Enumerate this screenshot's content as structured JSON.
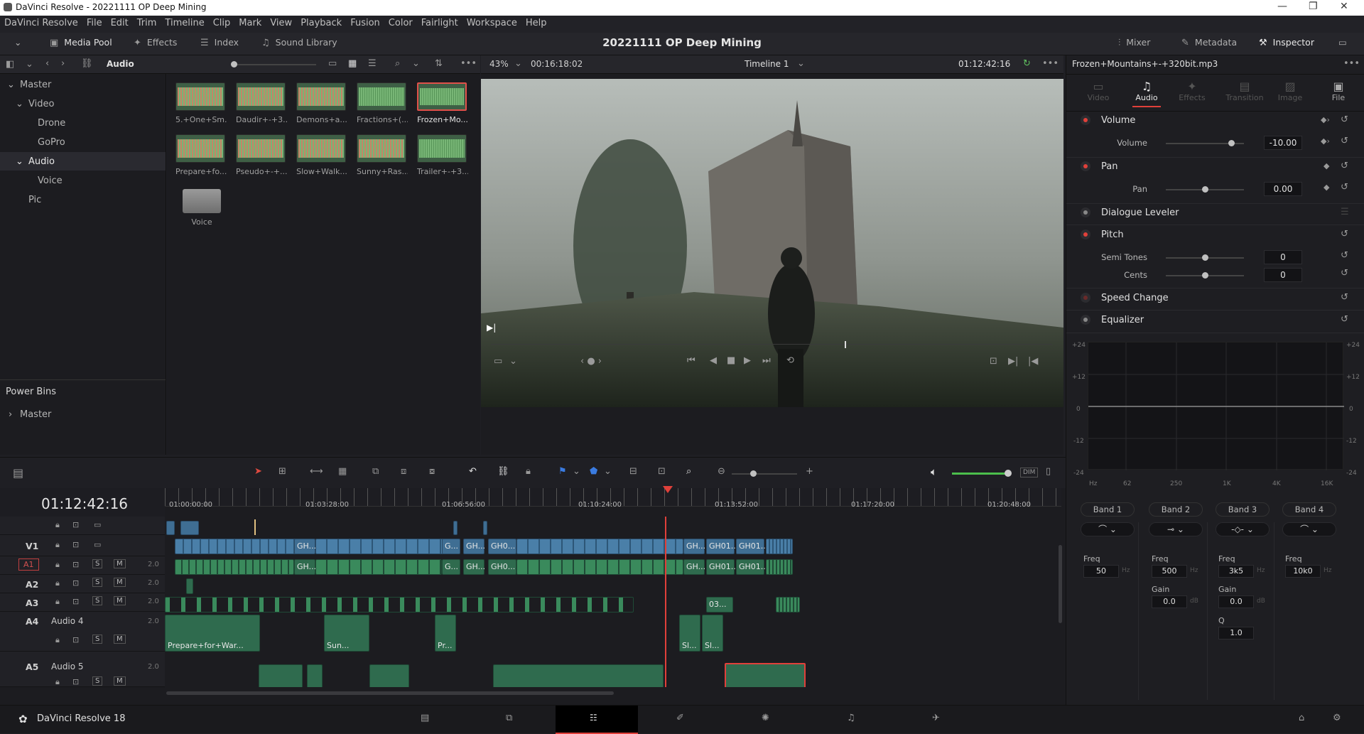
{
  "window": {
    "title": "DaVinci Resolve - 20221111 OP Deep Mining"
  },
  "menu": [
    "DaVinci Resolve",
    "File",
    "Edit",
    "Trim",
    "Timeline",
    "Clip",
    "Mark",
    "View",
    "Playback",
    "Fusion",
    "Color",
    "Fairlight",
    "Workspace",
    "Help"
  ],
  "toolbar": {
    "media_pool": "Media Pool",
    "effects": "Effects",
    "index": "Index",
    "sound_library": "Sound Library",
    "project_title": "20221111 OP Deep Mining",
    "mixer": "Mixer",
    "metadata": "Metadata",
    "inspector": "Inspector"
  },
  "media_pool": {
    "current_bin": "Audio",
    "bins": [
      {
        "label": "Master"
      },
      {
        "label": "Video"
      },
      {
        "label": "Drone"
      },
      {
        "label": "GoPro"
      },
      {
        "label": "Audio"
      },
      {
        "label": "Voice"
      },
      {
        "label": "Pic"
      }
    ],
    "power_bins_title": "Power Bins",
    "power_bins_master": "Master",
    "clips": [
      "5.+One+Sm...",
      "Daudir+-+3...",
      "Demons+a...",
      "Fractions+(...",
      "Frozen+Mo...",
      "Prepare+fo...",
      "Pseudo+-+...",
      "Slow+Walk...",
      "Sunny+Ras...",
      "Trailer+-+3...",
      "Voice"
    ]
  },
  "viewer": {
    "zoom": "43%",
    "duration": "00:16:18:02",
    "timeline_name": "Timeline 1",
    "timecode": "01:12:42:16"
  },
  "inspector": {
    "clip_name": "Frozen+Mountains+-+320bit.mp3",
    "tabs": [
      "Video",
      "Audio",
      "Effects",
      "Transition",
      "Image",
      "File"
    ],
    "volume": {
      "title": "Volume",
      "param": "Volume",
      "value": "-10.00"
    },
    "pan": {
      "title": "Pan",
      "param": "Pan",
      "value": "0.00"
    },
    "dialogue": {
      "title": "Dialogue Leveler"
    },
    "pitch": {
      "title": "Pitch",
      "semitones_label": "Semi Tones",
      "semitones": "0",
      "cents_label": "Cents",
      "cents": "0"
    },
    "speed": {
      "title": "Speed Change"
    },
    "eq": {
      "title": "Equalizer",
      "y_labels": [
        "+24",
        "+12",
        "0",
        "-12",
        "-24"
      ],
      "x_labels": [
        "Hz",
        "62",
        "250",
        "1K",
        "4K",
        "16K"
      ],
      "bands": [
        {
          "label": "Band 1",
          "freq": "50"
        },
        {
          "label": "Band 2",
          "freq": "500",
          "gain": "0.0"
        },
        {
          "label": "Band 3",
          "freq": "3k5",
          "gain": "0.0",
          "q": "1.0"
        },
        {
          "label": "Band 4",
          "freq": "10k0"
        }
      ],
      "freq_label": "Freq",
      "gain_label": "Gain",
      "q_label": "Q",
      "hz": "Hz",
      "db": "dB"
    }
  },
  "timeline": {
    "timecode": "01:12:42:16",
    "ruler": [
      "01:00:00:00",
      "01:03:28:00",
      "01:06:56:00",
      "01:10:24:00",
      "01:13:52:00",
      "01:17:20:00",
      "01:20:48:00"
    ],
    "tracks": {
      "v1": "V1",
      "a1": "A1",
      "a2": "A2",
      "a3": "A3",
      "a4": "A4",
      "a4_name": "Audio 4",
      "a5": "A5",
      "a5_name": "Audio 5",
      "ch": "2.0"
    },
    "s": "S",
    "m": "M",
    "clip_labels": {
      "gh": "GH...",
      "g": "G...",
      "gh0": "GH0...",
      "gh01": "GH01...",
      "c03": "03...",
      "prepare": "Prepare+for+War...",
      "sun": "Sun...",
      "pr": "Pr...",
      "sl": "Sl..."
    }
  },
  "dim": "DIM",
  "app_version": "DaVinci Resolve 18"
}
